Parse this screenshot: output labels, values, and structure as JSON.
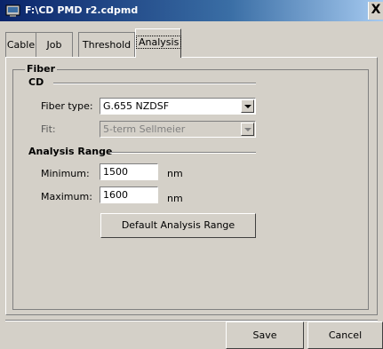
{
  "window": {
    "title": "F:\\CD PMD r2.cdpmd",
    "close_label": "X"
  },
  "tabs": [
    {
      "label": "Cable",
      "active": false
    },
    {
      "label": "Job",
      "active": false
    },
    {
      "label": "Threshold",
      "active": false
    },
    {
      "label": "Analysis",
      "active": true
    }
  ],
  "fiber": {
    "group_label": "Fiber",
    "cd_label": "CD",
    "fiber_type_label": "Fiber type:",
    "fiber_type_value": "G.655 NZDSF",
    "fit_label": "Fit:",
    "fit_value": "5-term Sellmeier"
  },
  "analysis_range": {
    "label": "Analysis Range",
    "minimum_label": "Minimum:",
    "minimum_value": "1500",
    "maximum_label": "Maximum:",
    "maximum_value": "1600",
    "unit": "nm",
    "default_button": "Default Analysis Range"
  },
  "footer": {
    "save_button": "Save",
    "cancel_button": "Cancel"
  }
}
